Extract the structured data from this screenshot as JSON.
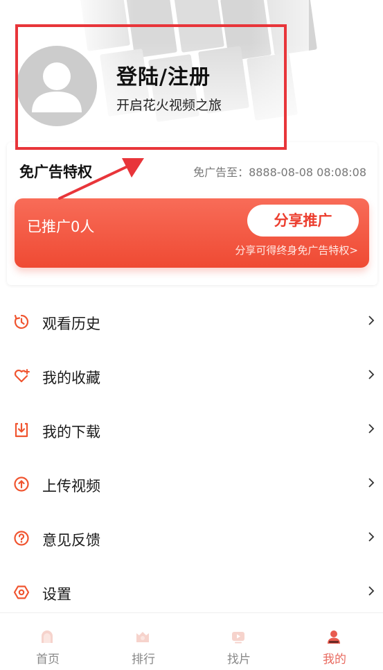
{
  "profile": {
    "login_title": "登陆/注册",
    "login_subtitle": "开启花火视频之旅"
  },
  "ad_free": {
    "title": "免广告特权",
    "expire_text": "免广告至：8888-08-08 08:08:08",
    "promoted_text": "已推广0人",
    "share_button": "分享推广",
    "share_hint": "分享可得终身免广告特权>"
  },
  "menu": {
    "items": [
      {
        "label": "观看历史",
        "icon": "history-icon"
      },
      {
        "label": "我的收藏",
        "icon": "heart-icon"
      },
      {
        "label": "我的下载",
        "icon": "download-icon"
      },
      {
        "label": "上传视频",
        "icon": "upload-icon"
      },
      {
        "label": "意见反馈",
        "icon": "question-icon"
      },
      {
        "label": "设置",
        "icon": "settings-icon"
      }
    ]
  },
  "bottom_nav": {
    "items": [
      {
        "label": "首页",
        "icon": "home-icon"
      },
      {
        "label": "排行",
        "icon": "ranking-icon"
      },
      {
        "label": "找片",
        "icon": "video-icon"
      },
      {
        "label": "我的",
        "icon": "profile-icon",
        "active": true
      }
    ]
  },
  "colors": {
    "accent": "#ec3d2e",
    "icon_orange": "#f0542f",
    "annotation_red": "#e8353a"
  }
}
